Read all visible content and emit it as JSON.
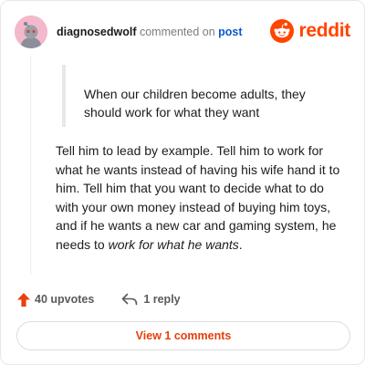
{
  "comment": {
    "username": "diagnosedwolf",
    "action_text": "commented on",
    "post_link_text": "post",
    "quote": "When our children become adults, they should work for what they want",
    "body_plain": "Tell him to lead by example. Tell him to work for what he wants instead of having his wife hand it to him. Tell him that you want to decide what to do with your own money instead of buying him toys, and if he wants a new car and gaming system, he needs to ",
    "body_emphasis": "work for what he wants",
    "body_end": "."
  },
  "brand": {
    "wordmark": "reddit",
    "icon": "reddit-alien-icon",
    "color": "#ff4500"
  },
  "stats": {
    "upvotes_label": "40 upvotes",
    "replies_label": "1 reply"
  },
  "view_button": {
    "label": "View 1 comments"
  },
  "colors": {
    "accent": "#ff4500",
    "link": "#0a58d0",
    "button_text": "#e83e0c",
    "avatar_bg": "#f4b8cc"
  },
  "icons": {
    "upvote": "upvote-arrow-icon",
    "reply": "reply-arrow-icon",
    "avatar": "snoo-avatar-icon"
  }
}
